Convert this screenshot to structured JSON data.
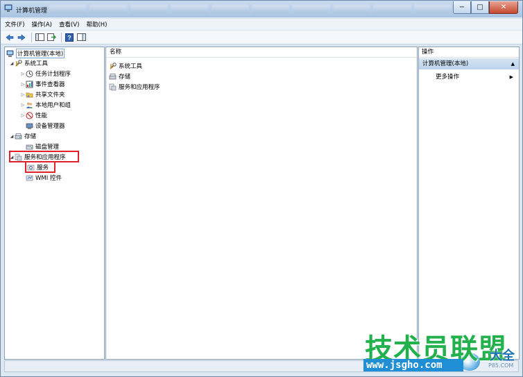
{
  "window": {
    "title": "计算机管理",
    "controls": {
      "minimize": "−",
      "maximize": "□",
      "close": "✕"
    }
  },
  "menu": [
    {
      "label": "文件(F)"
    },
    {
      "label": "操作(A)"
    },
    {
      "label": "查看(V)"
    },
    {
      "label": "帮助(H)"
    }
  ],
  "toolbar": {
    "icons": [
      "back-arrow-icon",
      "forward-arrow-icon",
      "show-hide-tree-icon",
      "export-list-icon",
      "help-icon",
      "show-hide-action-pane-icon"
    ]
  },
  "tree": {
    "root": "计算机管理(本地)",
    "system_tools": "系统工具",
    "task_scheduler": "任务计划程序",
    "event_viewer": "事件查看器",
    "shared_folders": "共享文件夹",
    "local_users": "本地用户和组",
    "performance": "性能",
    "device_manager": "设备管理器",
    "storage": "存储",
    "disk_management": "磁盘管理",
    "services_apps": "服务和应用程序",
    "services": "服务",
    "wmi": "WMI 控件"
  },
  "list": {
    "column_name": "名称",
    "rows": [
      "系统工具",
      "存储",
      "服务和应用程序"
    ]
  },
  "actions": {
    "header": "操作",
    "section": "计算机管理(本地)",
    "more": "更多操作"
  },
  "watermark": {
    "main": "技术员联盟",
    "side": "大全",
    "url": "www.jsgho.com",
    "sub": "P85.COM"
  },
  "colors": {
    "highlight_box": "#e0202a",
    "selection_bar": "#bcd3ec",
    "watermark_green": "#22b14c",
    "watermark_blue": "#1f8ed4"
  }
}
